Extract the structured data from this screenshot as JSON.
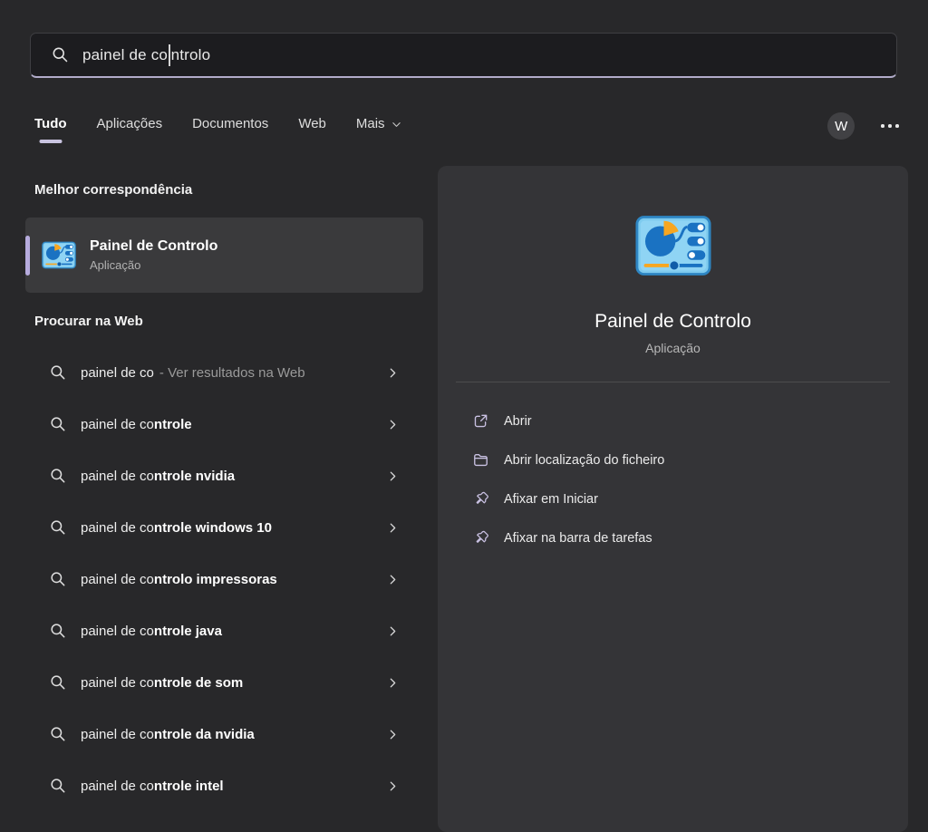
{
  "search": {
    "text_before_cursor": "painel de co",
    "text_after_cursor": "ntrolo"
  },
  "tabs": [
    {
      "label": "Tudo",
      "active": true
    },
    {
      "label": "Aplicações"
    },
    {
      "label": "Documentos"
    },
    {
      "label": "Web"
    },
    {
      "label": "Mais",
      "has_chevron": true
    }
  ],
  "header": {
    "avatar_letter": "W"
  },
  "sections": {
    "best_match": {
      "title": "Melhor correspondência",
      "item": {
        "name": "Painel de Controlo",
        "type": "Aplicação"
      }
    },
    "web_search": {
      "title": "Procurar na Web",
      "items": [
        {
          "typed": "painel de co",
          "suffix": "",
          "annotation": "- Ver resultados na Web"
        },
        {
          "typed": "painel de co",
          "suffix": "ntrole"
        },
        {
          "typed": "painel de co",
          "suffix": "ntrole nvidia"
        },
        {
          "typed": "painel de co",
          "suffix": "ntrole windows 10"
        },
        {
          "typed": "painel de co",
          "suffix": "ntrolo impressoras"
        },
        {
          "typed": "painel de co",
          "suffix": "ntrole java"
        },
        {
          "typed": "painel de co",
          "suffix": "ntrole de som"
        },
        {
          "typed": "painel de co",
          "suffix": "ntrole da nvidia"
        },
        {
          "typed": "painel de co",
          "suffix": "ntrole intel"
        }
      ]
    }
  },
  "preview": {
    "app_name": "Painel de Controlo",
    "app_type": "Aplicação",
    "actions": [
      {
        "label": "Abrir",
        "icon": "open-external-icon"
      },
      {
        "label": "Abrir localização do ficheiro",
        "icon": "folder-icon"
      },
      {
        "label": "Afixar em Iniciar",
        "icon": "pin-icon"
      },
      {
        "label": "Afixar na barra de tarefas",
        "icon": "pin-icon"
      }
    ]
  },
  "colors": {
    "background": "#28282a",
    "panel": "#343437",
    "card": "#3a3a3c",
    "accent_lavender": "#b6abdd",
    "search_underline": "#b1abc9",
    "icon_blue": "#1a72c2",
    "icon_light_blue": "#7ecbef",
    "icon_orange": "#f7a621"
  }
}
